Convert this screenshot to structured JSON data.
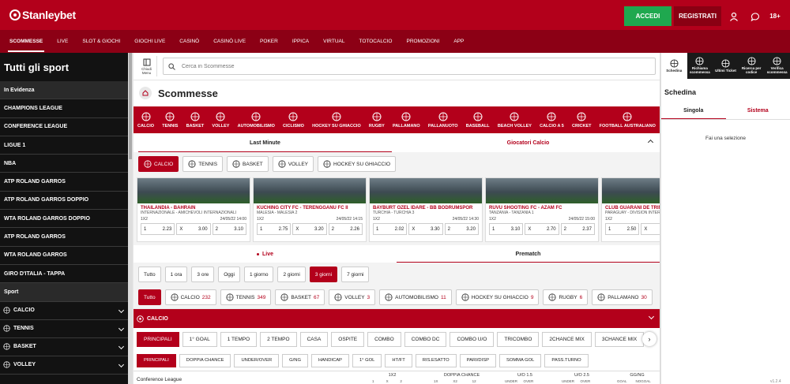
{
  "brand": {
    "name": "Stanleybet"
  },
  "header": {
    "login_label": "ACCEDI",
    "register_label": "REGISTRATI",
    "age_label": "18+"
  },
  "menu": [
    {
      "label": "SCOMMESSE",
      "active": true
    },
    {
      "label": "LIVE"
    },
    {
      "label": "SLOT & GIOCHI"
    },
    {
      "label": "GIOCHI LIVE"
    },
    {
      "label": "CASINÒ"
    },
    {
      "label": "CASINÒ LIVE"
    },
    {
      "label": "POKER"
    },
    {
      "label": "IPPICA"
    },
    {
      "label": "VIRTUAL"
    },
    {
      "label": "TOTOCALCIO"
    },
    {
      "label": "PROMOZIONI"
    },
    {
      "label": "APP"
    }
  ],
  "sidebar": {
    "title": "Tutti gli sport",
    "highlight_header": "In Evidenza",
    "items": [
      "CHAMPIONS LEAGUE",
      "CONFERENCE LEAGUE",
      "LIGUE 1",
      "NBA",
      "ATP ROLAND GARROS",
      "ATP ROLAND GARROS DOPPIO",
      "WTA ROLAND GARROS DOPPIO",
      "ATP ROLAND GARROS",
      "WTA ROLAND GARROS",
      "GIRO D'ITALIA - TAPPA"
    ],
    "sport_header": "Sport",
    "sports": [
      "CALCIO",
      "TENNIS",
      "BASKET",
      "VOLLEY"
    ]
  },
  "search": {
    "hide_label": "Chiudi Menu",
    "placeholder": "Cerca in Scommesse"
  },
  "page": {
    "title": "Scommesse"
  },
  "sports_bar": [
    "CALCIO",
    "TENNIS",
    "BASKET",
    "VOLLEY",
    "AUTOMOBILISMO",
    "CICLISMO",
    "HOCKEY SU GHIACCIO",
    "RUGBY",
    "PALLAMANO",
    "PALLANUOTO",
    "BASEBALL",
    "BEACH VOLLEY",
    "CALCIO A 5",
    "CRICKET",
    "FOOTBALL AUSTRALIANO"
  ],
  "tabs_top": {
    "left": "Last Minute",
    "right": "Giocatori Calcio"
  },
  "sport_pills": [
    {
      "label": "CALCIO",
      "on": true
    },
    {
      "label": "TENNIS"
    },
    {
      "label": "BASKET"
    },
    {
      "label": "VOLLEY"
    },
    {
      "label": "HOCKEY SU GHIACCIO"
    }
  ],
  "cards": [
    {
      "name": "THAILANDIA - BAHRAIN",
      "league": "INTERNAZIONALE - AMICHEVOLI INTERNAZIONALI",
      "market": "1X2",
      "time": "24/05/22 14:00",
      "odds": [
        [
          "1",
          "2.23"
        ],
        [
          "X",
          "3.00"
        ],
        [
          "2",
          "3.10"
        ]
      ]
    },
    {
      "name": "KUCHING CITY FC - TERENGGANU FC II",
      "league": "MALESIA - MALESIA 2",
      "market": "1X2",
      "time": "24/05/22 14:15",
      "odds": [
        [
          "1",
          "2.75"
        ],
        [
          "X",
          "3.20"
        ],
        [
          "2",
          "2.26"
        ]
      ]
    },
    {
      "name": "BAYBURT OZEL IDARE - BB BODRUMSPOR",
      "league": "TURCHIA - TURCHIA 3",
      "market": "1X2",
      "time": "24/05/22 14:30",
      "odds": [
        [
          "1",
          "2.02"
        ],
        [
          "X",
          "3.30"
        ],
        [
          "2",
          "3.20"
        ]
      ]
    },
    {
      "name": "RUVU SHOOTING FC - AZAM FC",
      "league": "TANZANIA - TANZANIA 1",
      "market": "1X2",
      "time": "24/05/22 15:00",
      "odds": [
        [
          "1",
          "3.10"
        ],
        [
          "X",
          "2.70"
        ],
        [
          "2",
          "2.37"
        ]
      ]
    },
    {
      "name": "CLUB GUARANI DE TRINIDAD",
      "league": "PARAGUAY - DIVISION INTERMEDIA",
      "market": "1X2",
      "time": "",
      "odds": [
        [
          "1",
          "2.50"
        ],
        [
          "X",
          ""
        ],
        [
          "2",
          ""
        ]
      ]
    }
  ],
  "tabs_mid": {
    "live": "Live",
    "prematch": "Prematch"
  },
  "days": [
    {
      "label": "Tutto"
    },
    {
      "label": "1 ora"
    },
    {
      "label": "3 ore"
    },
    {
      "label": "Oggi"
    },
    {
      "label": "1 giorno"
    },
    {
      "label": "2 giorni"
    },
    {
      "label": "3 giorni",
      "on": true
    },
    {
      "label": "7 giorni"
    }
  ],
  "sport_filter": [
    {
      "label": "Tutto",
      "count": "",
      "on": true
    },
    {
      "label": "CALCIO",
      "count": "232"
    },
    {
      "label": "TENNIS",
      "count": "349"
    },
    {
      "label": "BASKET",
      "count": "67"
    },
    {
      "label": "VOLLEY",
      "count": "3"
    },
    {
      "label": "AUTOMOBILISMO",
      "count": "11"
    },
    {
      "label": "HOCKEY SU GHIACCIO",
      "count": "9"
    },
    {
      "label": "RUGBY",
      "count": "6"
    },
    {
      "label": "PALLAMANO",
      "count": "30"
    }
  ],
  "section": {
    "title": "CALCIO"
  },
  "market_groups": [
    {
      "label": "PRINCIPALI",
      "on": true
    },
    {
      "label": "1° GOAL"
    },
    {
      "label": "1 TEMPO"
    },
    {
      "label": "2 TEMPO"
    },
    {
      "label": "CASA"
    },
    {
      "label": "OSPITE"
    },
    {
      "label": "COMBO"
    },
    {
      "label": "COMBO DC"
    },
    {
      "label": "COMBO U/O"
    },
    {
      "label": "TRICOMBO"
    },
    {
      "label": "2CHANCE MIX"
    },
    {
      "label": "3CHANCE MIX"
    }
  ],
  "markets": [
    {
      "label": "PRINCIPALI",
      "on": true
    },
    {
      "label": "DOPPIA CHANCE"
    },
    {
      "label": "UNDER/OVER"
    },
    {
      "label": "G/NG"
    },
    {
      "label": "HANDICAP"
    },
    {
      "label": "1° GOL"
    },
    {
      "label": "HT/FT"
    },
    {
      "label": "RIS.ESATTO"
    },
    {
      "label": "PARI/DISP"
    },
    {
      "label": "SOMMA GOL"
    },
    {
      "label": "PASS.TURNO"
    }
  ],
  "table": {
    "league": "Conference League",
    "groups": [
      {
        "label": "1X2",
        "subs": [
          "1",
          "X",
          "2"
        ]
      },
      {
        "label": "DOPPIA CHANCE",
        "subs": [
          "1X",
          "X2",
          "12"
        ]
      },
      {
        "label": "U/O 1.5",
        "subs": [
          "UNDER",
          "OVER"
        ]
      },
      {
        "label": "U/O 2.5",
        "subs": [
          "UNDER",
          "OVER"
        ]
      },
      {
        "label": "GG/NG",
        "subs": [
          "GOAL",
          "NOGOAL"
        ]
      }
    ]
  },
  "right_panel": {
    "tabs": [
      "Schedina",
      "Richiama scommessa",
      "Ultimi Ticket",
      "Ricerca per codice",
      "Verifica scommessa"
    ],
    "title": "Schedina",
    "sub_tabs": [
      "Singola",
      "Sistema"
    ],
    "empty_text": "Fai una selezione"
  },
  "version": "v1.2.4"
}
